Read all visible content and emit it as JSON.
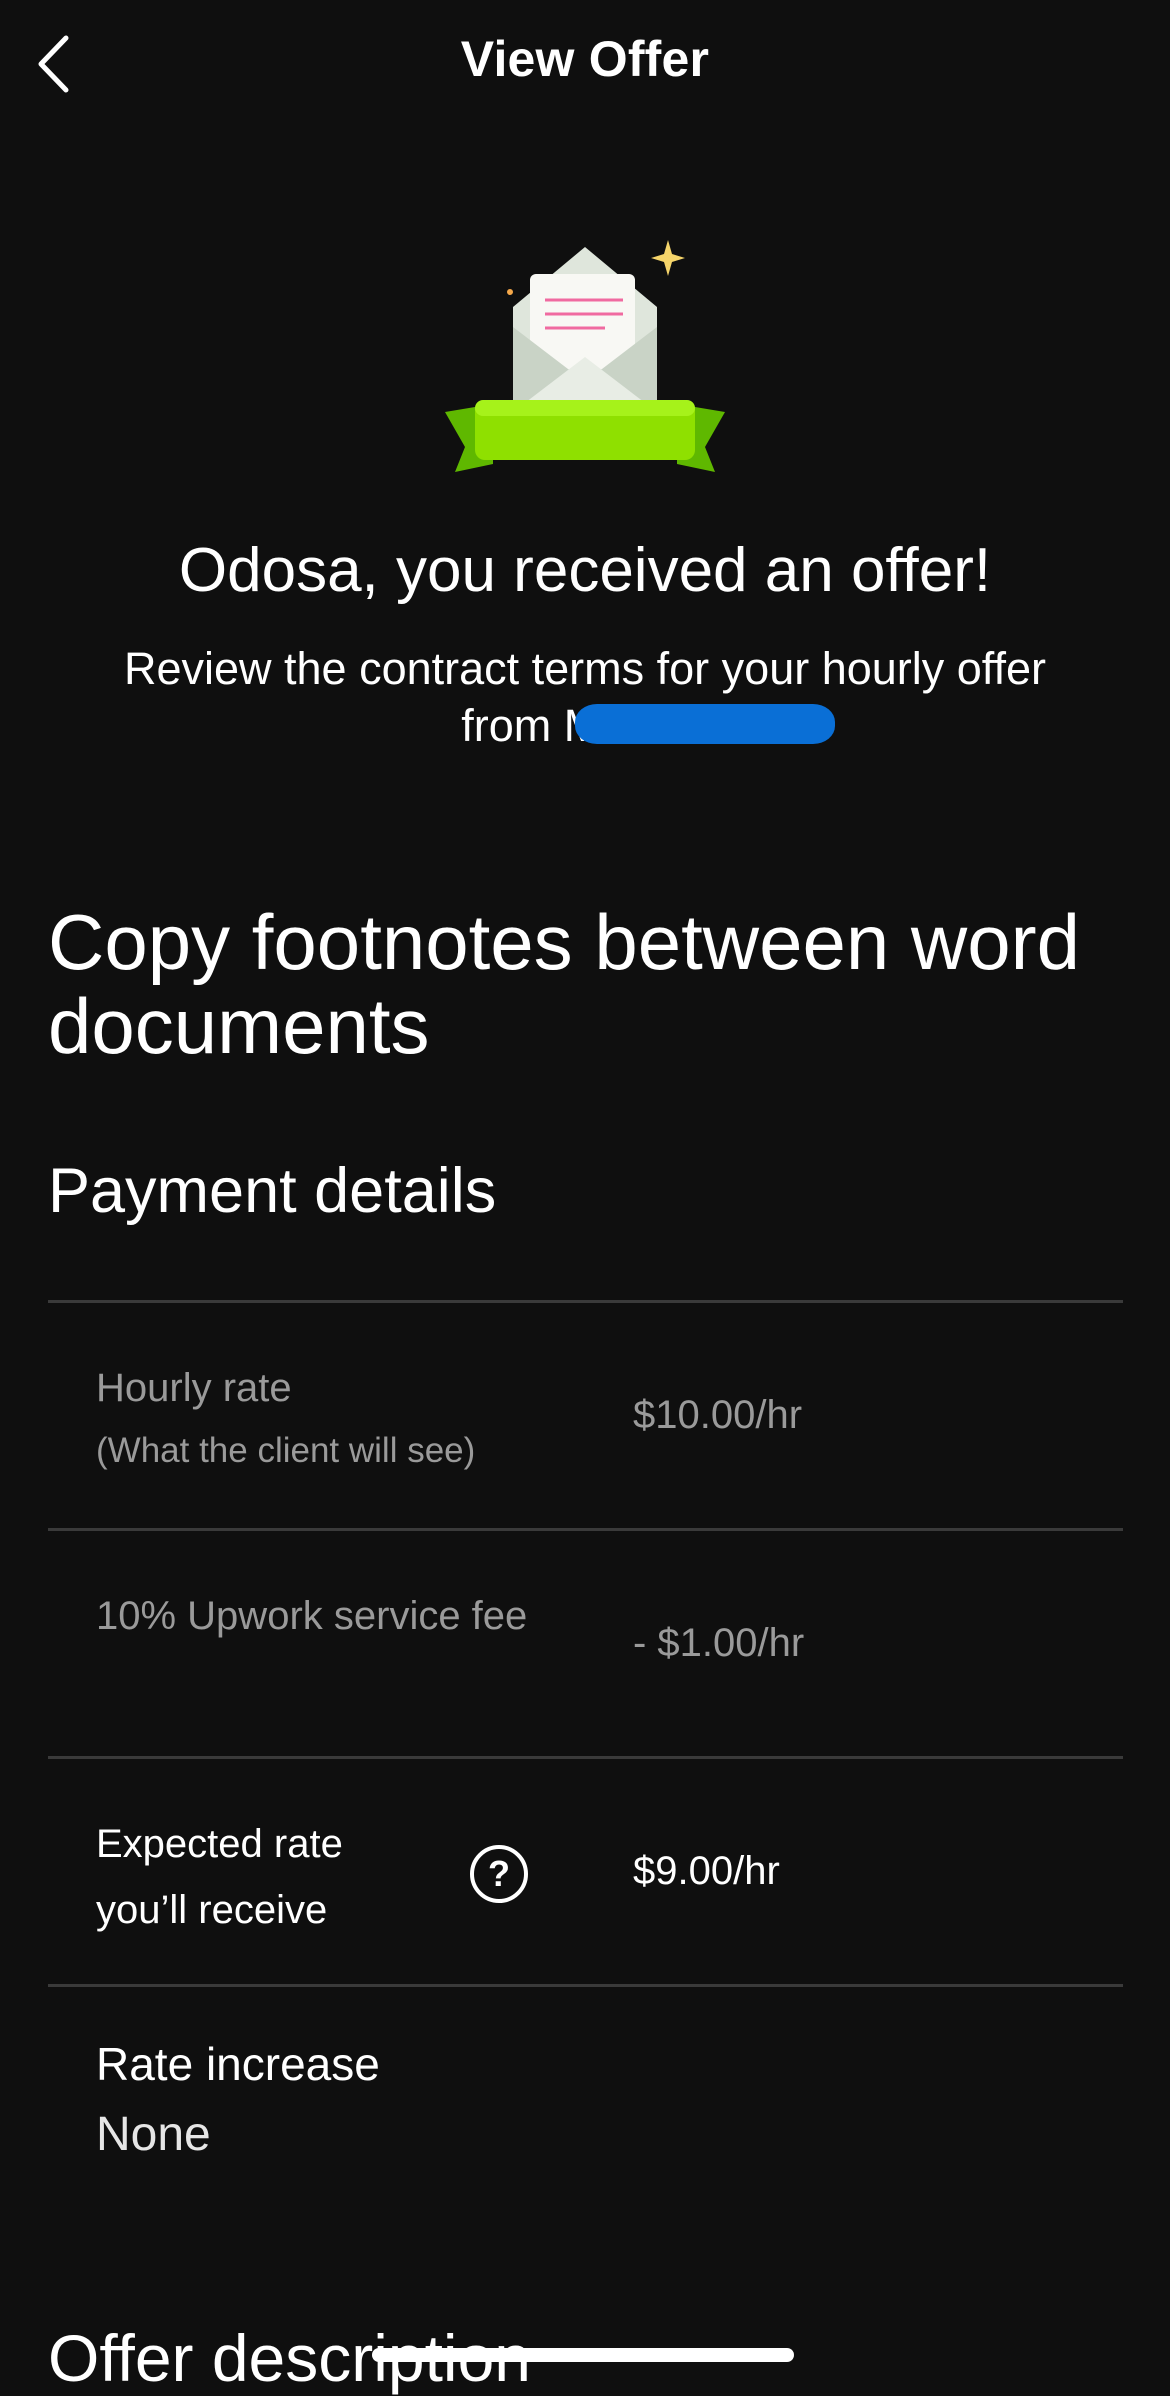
{
  "header": {
    "title": "View Offer",
    "back_icon": "chevron-left-icon"
  },
  "hero": {
    "illustration_icon": "envelope-ribbon-icon",
    "headline": "Odosa, you received an offer!",
    "subline": "Review the contract terms for your hourly offer from Mich e."
  },
  "job": {
    "title": "Copy footnotes between word documents"
  },
  "payment": {
    "section_title": "Payment details",
    "rows": [
      {
        "label": "Hourly rate",
        "sublabel": "(What the client will see)",
        "value": "$10.00/hr"
      },
      {
        "label": "10% Upwork service fee",
        "value": "- $1.00/hr"
      },
      {
        "label": "Expected rate you’ll receive",
        "value": "$9.00/hr",
        "help_icon": "question-circle-icon"
      }
    ],
    "rate_increase": {
      "label": "Rate increase",
      "value": "None"
    }
  },
  "offer_description": {
    "title": "Offer description"
  },
  "colors": {
    "background": "#0f0f0f",
    "muted_text": "#9a9a9a",
    "divider": "#3a3a3a",
    "ribbon_green": "#8fe000",
    "redaction_blue": "#0a6fd6"
  }
}
